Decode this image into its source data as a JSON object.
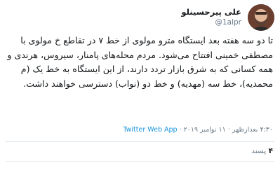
{
  "tweet": {
    "display_name": "علی پیرحسینلو",
    "handle": "@1alpr",
    "text": "تا دو سه هفته بعد ایستگاه مترو مولوی از خط ۷ در تقاطع خ مولوی با مصطفی خمینی افتتاح می‌شود. مردم محله‌های پامنار، سیروس، هرندی و همه کسانی که به شرق بازار تردد دارند، از این ایستگاه به خط یک (م محمدیه)، خط سه (مهدیه) و خط دو (نواب) دسترسی خواهند داشت.",
    "time": "۴:۳۰ بعدازظهر",
    "date": "۱۱ نوامبر ۲۰۱۹",
    "separator": "·",
    "source": "Twitter Web App",
    "likes_count": "۴",
    "likes_label": "پسند"
  },
  "colors": {
    "text": "#14171a",
    "secondary": "#657786",
    "link": "#1b95e0",
    "divider": "#e1e8ed"
  }
}
